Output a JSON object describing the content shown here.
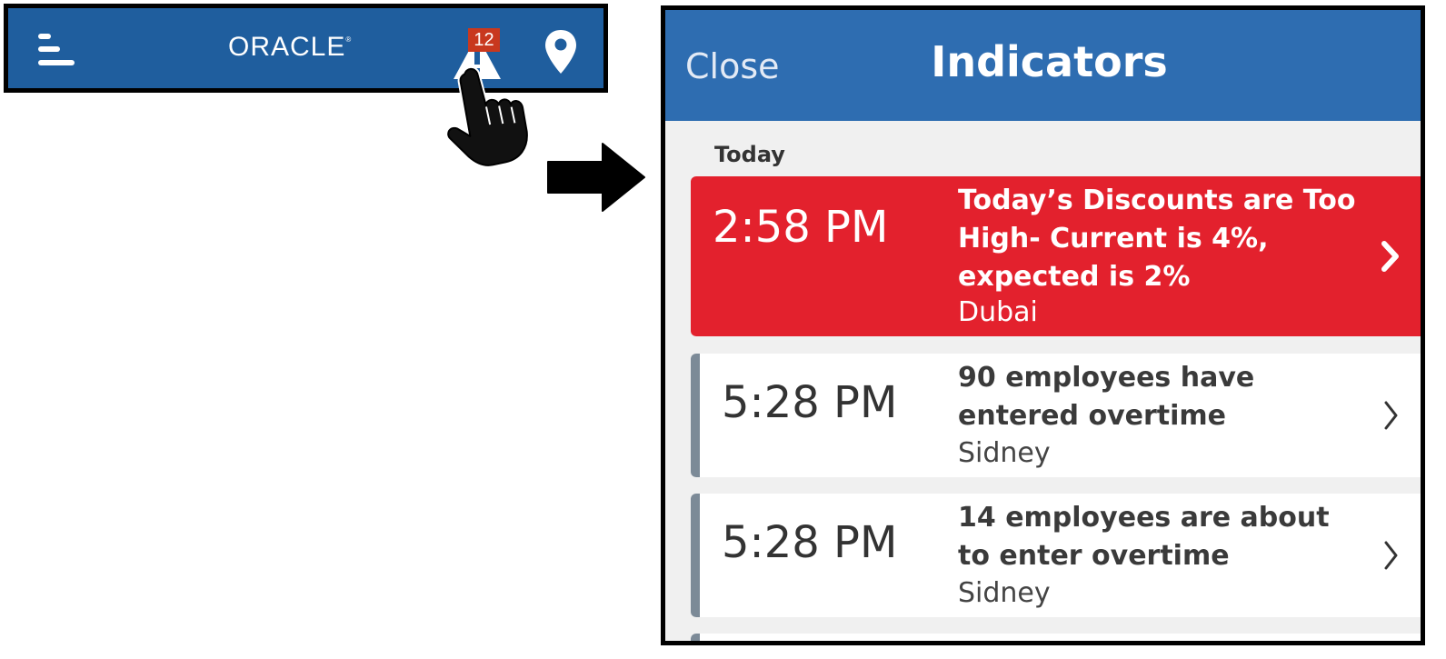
{
  "header": {
    "logo_text": "ORACLE",
    "alert_count": "12",
    "brand_color": "#1f5e9e",
    "icons": [
      "hamburger-menu-icon",
      "alert-warning-icon",
      "location-pin-icon"
    ]
  },
  "indicators": {
    "close_label": "Close",
    "title": "Indicators",
    "section_label": "Today",
    "items": [
      {
        "time": "2:58 PM",
        "title": "Today’s Discounts are Too High- Current is 4%, expected is 2%",
        "location": "Dubai",
        "severity": "critical",
        "color": "#e3212d"
      },
      {
        "time": "5:28 PM",
        "title": "90 employees have entered overtime",
        "location": "Sidney",
        "severity": "normal"
      },
      {
        "time": "5:28 PM",
        "title": "14 employees are about to enter overtime",
        "location": "Sidney",
        "severity": "normal"
      }
    ]
  }
}
